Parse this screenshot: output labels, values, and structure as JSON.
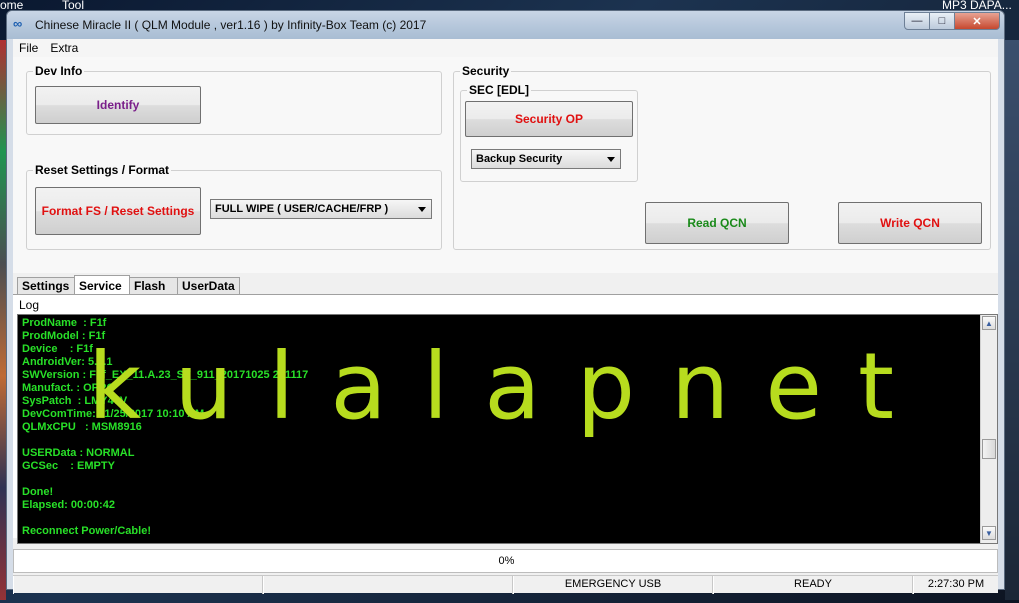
{
  "desktop": {
    "label_left": "ome",
    "label_tool": "Tool",
    "label_right": "MP3 DAPA..."
  },
  "window": {
    "title": "Chinese Miracle II ( QLM Module , ver1.16  ) by Infinity-Box Team (c) 2017",
    "controls": {
      "minimize": "—",
      "maximize": "□",
      "close": "✕"
    }
  },
  "menu": [
    "File",
    "Extra"
  ],
  "dev_info": {
    "title": "Dev Info",
    "identify_label": "Identify"
  },
  "reset": {
    "title": "Reset Settings / Format",
    "button_label": "Format FS / Reset Settings",
    "combo_value": "FULL WIPE ( USER/CACHE/FRP )"
  },
  "security": {
    "title": "Security",
    "sec_edl_title": "SEC [EDL]",
    "security_op_label": "Security OP",
    "combo_value": "Backup Security",
    "read_qcn_label": "Read QCN",
    "write_qcn_label": "Write QCN"
  },
  "tabs": [
    "Settings",
    "Service",
    "Flash",
    "UserData"
  ],
  "active_tab": "Service",
  "log": {
    "label": "Log",
    "lines": [
      "ProdName  : F1f",
      "ProdModel : F1f",
      "Device    : F1f",
      "AndroidVer: 5.1.1",
      "SWVersion : F1f_EX_11.A.23_ST_911_20171025 251117",
      "Manufact. : OPPO",
      "SysPatch  : LMY47V",
      "DevComTime: 11/25/2017 10:10 AM",
      "QLMxCPU   : MSM8916",
      "",
      "USERData : NORMAL",
      "GCSec    : EMPTY",
      "",
      "Done!",
      "Elapsed: 00:00:42",
      "",
      "Reconnect Power/Cable!"
    ],
    "watermark": "kulalapnet"
  },
  "progress": {
    "text": "0%"
  },
  "status": {
    "cell1": "",
    "cell2": "",
    "connection": "EMERGENCY USB",
    "state": "READY",
    "time": "2:27:30 PM"
  },
  "colors": {
    "log_text": "#28e028",
    "identify": "#7a1f8a",
    "red_button": "#e01010",
    "green_button": "#1a8a1a",
    "watermark": "#b7dc1e"
  }
}
